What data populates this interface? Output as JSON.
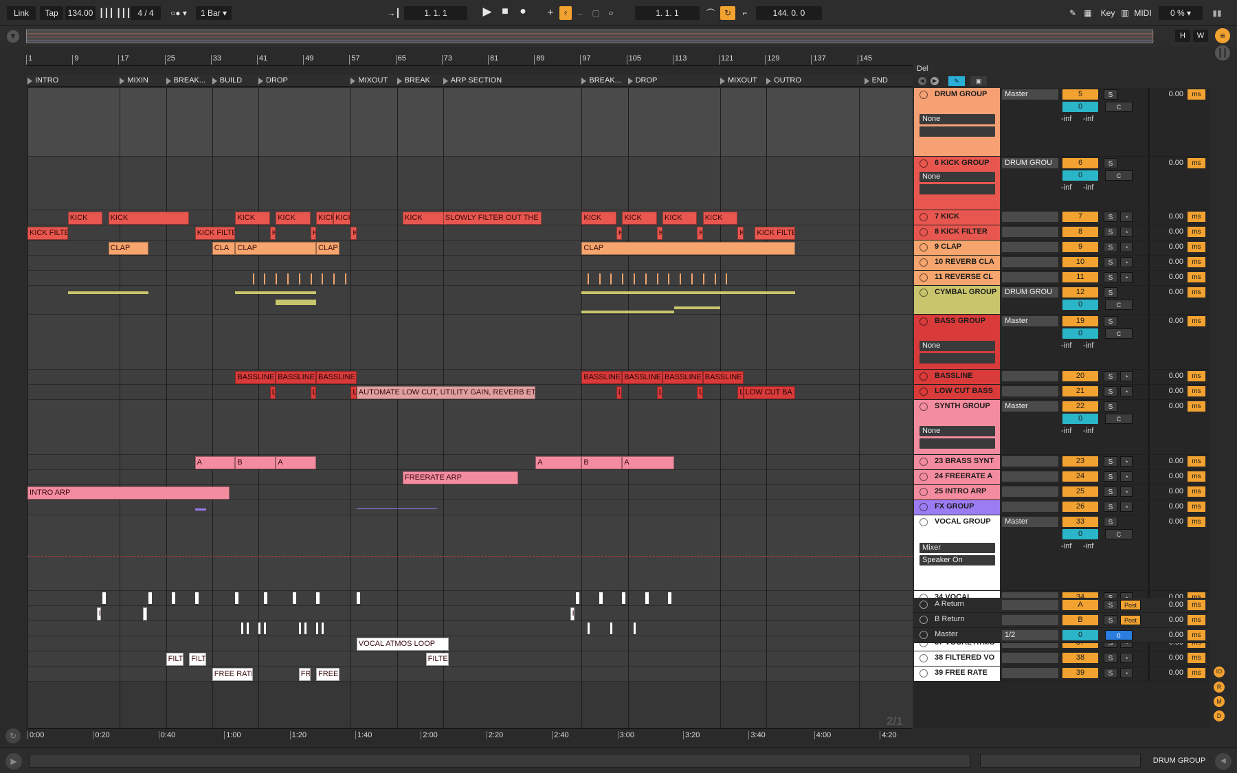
{
  "toolbar": {
    "link": "Link",
    "tap": "Tap",
    "tempo": "134.00",
    "signature": "4 / 4",
    "quantize": "1 Bar",
    "position": "1.   1.   1",
    "loop_start": "1.   1.   1",
    "loop_length": "144.   0.   0",
    "key": "Key",
    "midi": "MIDI",
    "cpu": "0 %"
  },
  "overview": {
    "h": "H",
    "w": "W"
  },
  "ruler": [
    "1",
    "9",
    "17",
    "25",
    "33",
    "41",
    "49",
    "57",
    "65",
    "73",
    "81",
    "89",
    "97",
    "105",
    "113",
    "121",
    "129",
    "137",
    "145"
  ],
  "locators": [
    "INTRO",
    "MIXIN",
    "BREAK...",
    "BUILD",
    "DROP",
    "MIXOUT",
    "BREAK",
    "ARP SECTION",
    "BREAK...",
    "DROP",
    "MIXOUT",
    "OUTRO",
    "END"
  ],
  "time_ruler": [
    "0:00",
    "0:20",
    "0:40",
    "1:00",
    "1:20",
    "1:40",
    "2:00",
    "2:20",
    "2:40",
    "3:00",
    "3:20",
    "3:40",
    "4:00",
    "4:20"
  ],
  "clips": {
    "kick": "KICK",
    "kick_filter": "KICK FILTER",
    "kick_filte": "KICK FILTE",
    "kick_filtere": "KICK FILTERE",
    "kick_short": "KICI",
    "slowly": "SLOWLY FILTER OUT THE",
    "clap": "CLAP",
    "cla": "CLA",
    "bassline": "BASSLINE",
    "automate": "AUTOMATE LOW CUT, UTILITY GAIN, REVERB ETC",
    "low_cut": "LOW CUT BA",
    "a": "A",
    "b": "B",
    "freerate_arp": "FREERATE ARP",
    "intro_arp": "INTRO ARP",
    "vocal_atmos": "VOCAL ATMOS LOOP",
    "filte": "FILTE",
    "filt": "FILT",
    "free_rate": "FREE RATE",
    "fr": "FR",
    "free_r": "FREE R",
    "l": "L",
    "k": "K",
    "f": "F"
  },
  "page_counter": "2/1",
  "io": {
    "del": "Del"
  },
  "tracks": [
    {
      "name": "DRUM GROUP",
      "route": "Master",
      "num": "5",
      "pan": "0",
      "c": "C",
      "inf1": "-inf",
      "inf2": "-inf",
      "input": "None",
      "delay": "0.00",
      "ms": "ms"
    },
    {
      "name": "6 KICK GROUP",
      "route": "DRUM GROU",
      "num": "6",
      "pan": "0",
      "c": "C",
      "inf1": "-inf",
      "inf2": "-inf",
      "input": "None",
      "delay": "0.00",
      "ms": "ms"
    },
    {
      "name": "7 KICK",
      "num": "7",
      "delay": "0.00",
      "ms": "ms"
    },
    {
      "name": "8 KICK FILTER",
      "num": "8",
      "delay": "0.00",
      "ms": "ms"
    },
    {
      "name": "9 CLAP",
      "num": "9",
      "delay": "0.00",
      "ms": "ms"
    },
    {
      "name": "10 REVERB CLA",
      "num": "10",
      "delay": "0.00",
      "ms": "ms"
    },
    {
      "name": "11 REVERSE CL",
      "num": "11",
      "delay": "0.00",
      "ms": "ms"
    },
    {
      "name": "CYMBAL GROUP",
      "route": "DRUM GROU",
      "num": "12",
      "pan": "0",
      "c": "C",
      "delay": "0.00",
      "ms": "ms"
    },
    {
      "name": "BASS GROUP",
      "route": "Master",
      "num": "19",
      "pan": "0",
      "c": "C",
      "inf1": "-inf",
      "inf2": "-inf",
      "input": "None",
      "delay": "0.00",
      "ms": "ms"
    },
    {
      "name": "BASSLINE",
      "num": "20",
      "delay": "0.00",
      "ms": "ms"
    },
    {
      "name": "LOW CUT BASS",
      "num": "21",
      "delay": "0.00",
      "ms": "ms"
    },
    {
      "name": "SYNTH GROUP",
      "route": "Master",
      "num": "22",
      "pan": "0",
      "c": "C",
      "inf1": "-inf",
      "inf2": "-inf",
      "input": "None",
      "delay": "0.00",
      "ms": "ms"
    },
    {
      "name": "23 BRASS SYNT",
      "num": "23",
      "delay": "0.00",
      "ms": "ms"
    },
    {
      "name": "24 FREERATE A",
      "num": "24",
      "delay": "0.00",
      "ms": "ms"
    },
    {
      "name": "25 INTRO ARP",
      "num": "25",
      "delay": "0.00",
      "ms": "ms"
    },
    {
      "name": "FX GROUP",
      "num": "26",
      "delay": "0.00",
      "ms": "ms"
    },
    {
      "name": "VOCAL GROUP",
      "route": "Master",
      "num": "33",
      "pan": "0",
      "c": "C",
      "inf1": "-inf",
      "inf2": "-inf",
      "mixer": "Mixer",
      "speaker": "Speaker On",
      "delay": "0.00",
      "ms": "ms"
    },
    {
      "name": "34 VOCAL",
      "num": "34",
      "delay": "0.00",
      "ms": "ms"
    },
    {
      "name": "35 REVERSE RE",
      "num": "35",
      "delay": "0.00",
      "ms": "ms"
    },
    {
      "name": "36 LOW VOX CH",
      "num": "36",
      "delay": "0.00",
      "ms": "ms"
    },
    {
      "name": "37 VOCAL ATMO",
      "num": "37",
      "delay": "0.00",
      "ms": "ms"
    },
    {
      "name": "38 FILTERED VO",
      "num": "38",
      "delay": "0.00",
      "ms": "ms"
    },
    {
      "name": "39 FREE RATE",
      "num": "39",
      "delay": "0.00",
      "ms": "ms"
    }
  ],
  "returns": [
    {
      "name": "A Return",
      "num": "A",
      "post": "Post",
      "delay": "0.00",
      "ms": "ms"
    },
    {
      "name": "B Return",
      "num": "B",
      "post": "Post",
      "delay": "0.00",
      "ms": "ms"
    },
    {
      "name": "Master",
      "route": "1/2",
      "num": "0",
      "num2": "0",
      "delay": "0.00",
      "ms": "ms"
    }
  ],
  "solo": "S",
  "side_letters": [
    "IO",
    "R",
    "M",
    "D"
  ],
  "status_track": "DRUM GROUP",
  "colors": {
    "drum": "#f7a074",
    "kick": "#e8574f",
    "clap": "#f5a56d",
    "cymbal": "#c9c56c",
    "bass": "#d93a3a",
    "synth": "#f48ca0",
    "fx": "#9b7cf2",
    "vocal": "#ffffff",
    "orange": "#f2a230"
  }
}
